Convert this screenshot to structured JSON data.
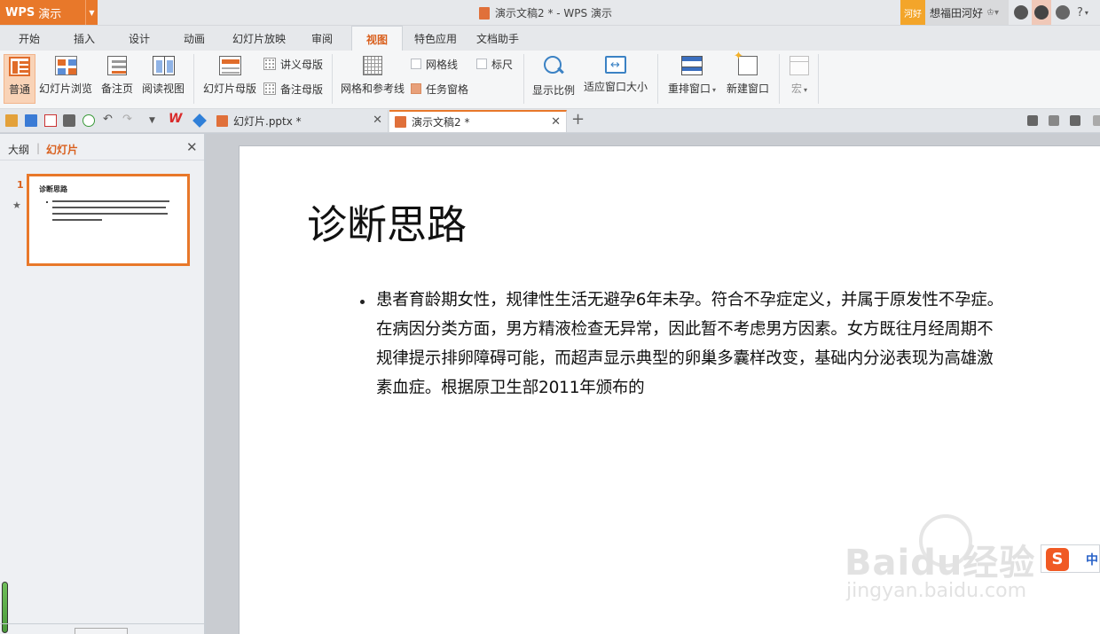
{
  "titlebar": {
    "app_logo": "WPS",
    "app_name": "演示",
    "doc_title": "演示文稿2 * - WPS 演示",
    "user_badge": "河好",
    "user_name": "想福田河好",
    "help": "?"
  },
  "menu_tabs": [
    "开始",
    "插入",
    "设计",
    "动画",
    "幻灯片放映",
    "审阅",
    "视图",
    "特色应用",
    "文档助手"
  ],
  "active_menu_tab": "视图",
  "ribbon": {
    "normal": "普通",
    "slide_sorter": "幻灯片浏览",
    "notes_page": "备注页",
    "reading_view": "阅读视图",
    "slide_master": "幻灯片母版",
    "handout_master": "讲义母版",
    "notes_master": "备注母版",
    "grid_guides": "网格和参考线",
    "gridlines": "网格线",
    "ruler": "标尺",
    "task_pane": "任务窗格",
    "zoom": "显示比例",
    "fit_window": "适应窗口大小",
    "arrange_all": "重排窗口",
    "new_window": "新建窗口",
    "macro": "宏",
    "gridlines_checked": false,
    "ruler_checked": false,
    "task_pane_checked": true
  },
  "doc_tabs": [
    {
      "label": "幻灯片.pptx *",
      "active": false
    },
    {
      "label": "演示文稿2 *",
      "active": true
    }
  ],
  "left_pane": {
    "tab_outline": "大纲",
    "tab_slides": "幻灯片",
    "slide_number": "1",
    "thumb_title": "诊断思路"
  },
  "slide": {
    "title": "诊断思路",
    "body": "患者育龄期女性，规律性生活无避孕6年未孕。符合不孕症定义，并属于原发性不孕症。在病因分类方面，男方精液检查无异常，因此暂不考虑男方因素。女方既往月经周期不规律提示排卵障碍可能，而超声显示典型的卵巢多囊样改变，基础内分泌表现为高雄激素血症。根据原卫生部2011年颁布的"
  },
  "watermark": {
    "logo": "Baidu经验",
    "sub": "jingyan.baidu.com"
  },
  "ime": {
    "logo": "S",
    "lang": "中"
  },
  "colors": {
    "accent": "#e8782a",
    "active_tab_text": "#d9601e",
    "ribbon_bg": "#f5f6f7"
  }
}
